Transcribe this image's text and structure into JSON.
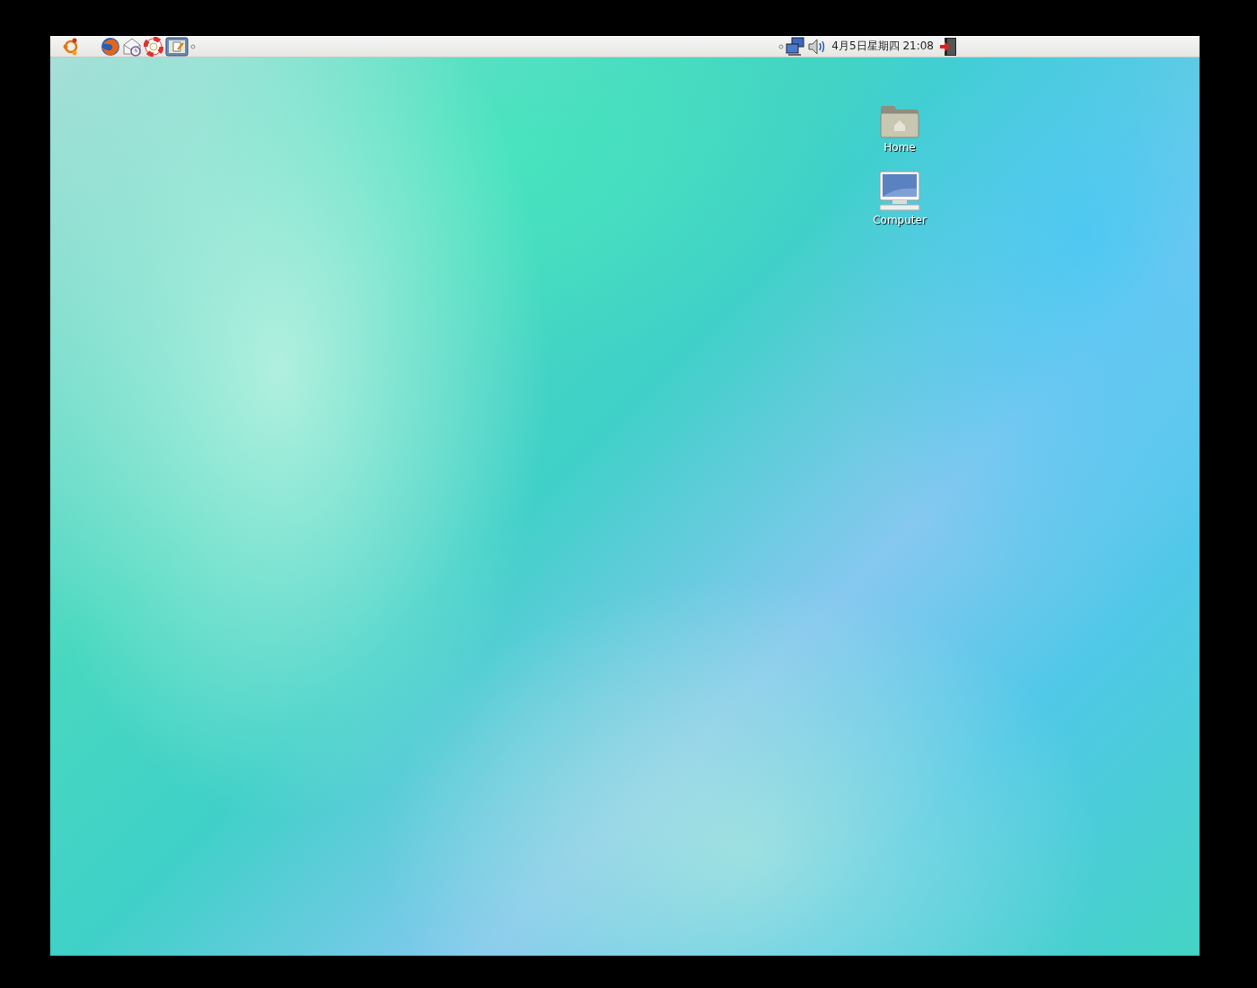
{
  "top_panel": {
    "clock": "4月5日星期四 21:08"
  },
  "desktop_icons": [
    {
      "kind": "folder",
      "label": "Home"
    },
    {
      "kind": "computer",
      "label": "Computer"
    }
  ]
}
